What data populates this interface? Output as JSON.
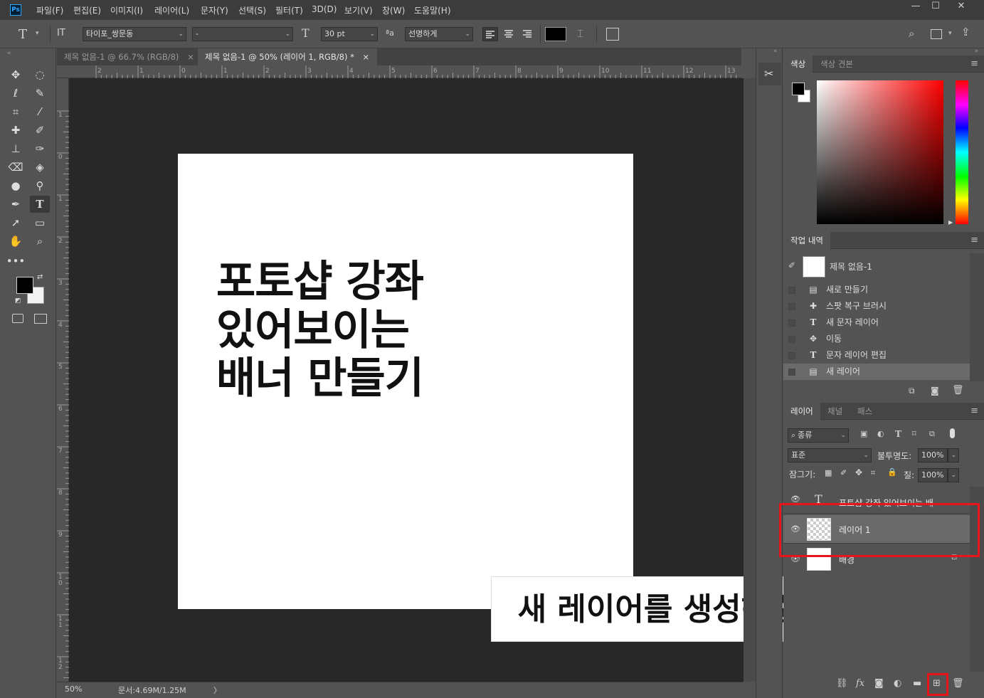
{
  "app": {
    "logo_text": "Ps"
  },
  "menu": [
    "파일(F)",
    "편집(E)",
    "이미지(I)",
    "레이어(L)",
    "문자(Y)",
    "선택(S)",
    "필터(T)",
    "3D(D)",
    "보기(V)",
    "창(W)",
    "도움말(H)"
  ],
  "window_controls": {
    "minimize": "—",
    "maximize": "☐",
    "close": "✕"
  },
  "options": {
    "tool_glyph": "T",
    "orient_glyph": "IT",
    "font_family": "타이포_쌍문동",
    "font_style": "-",
    "size_glyph": "T",
    "font_size": "30 pt",
    "aa_glyph": "ªa",
    "antialias": "선명하게",
    "text_color": "#000000"
  },
  "tabs": [
    {
      "label": "제목 없음-1 @ 66.7% (RGB/8)",
      "close": "×"
    },
    {
      "label": "제목 없음-1 @ 50% (레이어 1, RGB/8) *",
      "close": "×"
    }
  ],
  "ruler": {
    "h": [
      "2",
      "1",
      "0",
      "1",
      "2",
      "3",
      "4",
      "5",
      "6",
      "7",
      "8",
      "9",
      "10",
      "11",
      "12",
      "13"
    ],
    "v": [
      "1",
      "0",
      "1",
      "2",
      "3",
      "4",
      "5",
      "6",
      "7",
      "8",
      "9",
      "10",
      "11",
      "12"
    ]
  },
  "document": {
    "lines": [
      "포토샵 강좌",
      "있어보이는",
      "배너 만들기"
    ]
  },
  "caption": "새 레이어를 생성해준 뒤",
  "status": {
    "zoom": "50%",
    "doc": "문서:4.69M/1.25M",
    "arrow": "〉"
  },
  "colors": {
    "foreground": "#000000",
    "background": "#ffffff",
    "highlight": "#e8151d"
  },
  "color_panel": {
    "tabs": [
      "색상",
      "색상 견본"
    ]
  },
  "history_panel": {
    "title": "작업 내역",
    "snapshot": "제목 없음-1",
    "items": [
      {
        "icon": "document-icon",
        "label": "새로 만들기"
      },
      {
        "icon": "spot-healing-icon",
        "label": "스팟 복구 브러시"
      },
      {
        "icon": "type-icon",
        "label": "새 문자 레이어"
      },
      {
        "icon": "move-icon",
        "label": "이동"
      },
      {
        "icon": "type-icon",
        "label": "문자 레이어 편집"
      },
      {
        "icon": "document-icon",
        "label": "새 레이어"
      }
    ]
  },
  "layers_panel": {
    "tabs": [
      "레이어",
      "채널",
      "패스"
    ],
    "filter": "종류",
    "blend_mode": "표준",
    "opacity_label": "불투명도:",
    "opacity": "100%",
    "lock_label": "잠그기:",
    "fill_label": "칠:",
    "fill": "100%",
    "layers": [
      {
        "name": "포토샵 강좌 있어보이는 배",
        "type": "text"
      },
      {
        "name": "레이어 1",
        "type": "pixel",
        "selected": true
      },
      {
        "name": "배경",
        "type": "background"
      }
    ]
  }
}
